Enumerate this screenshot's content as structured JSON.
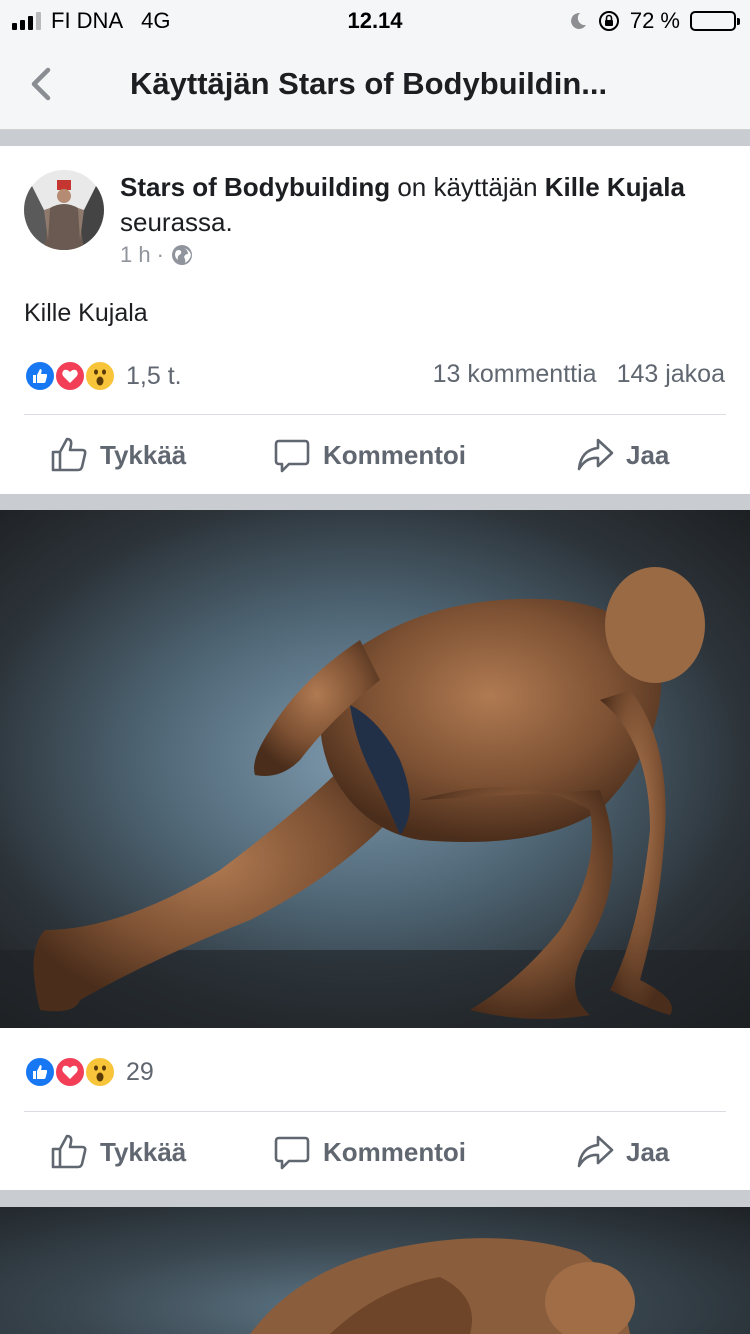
{
  "status_bar": {
    "carrier": "FI DNA",
    "network": "4G",
    "time": "12.14",
    "battery_text": "72 %",
    "battery_level": 0.72
  },
  "nav": {
    "back_icon": "chevron-left-icon",
    "title": "Käyttäjän Stars of Bodybuildin..."
  },
  "post": {
    "author": "Stars of Bodybuilding",
    "header_mid": " on käyttäjän ",
    "tagged": "Kille Kujala",
    "header_end": " seurassa.",
    "time": "1 h",
    "separator": "·",
    "privacy_icon": "globe-icon",
    "text": "Kille Kujala",
    "reaction_count": "1,5 t.",
    "comments": "13 kommenttia",
    "shares": "143 jakoa"
  },
  "actions": {
    "like": "Tykkää",
    "comment": "Kommentoi",
    "share": "Jaa"
  },
  "photo1": {
    "reaction_count": "29"
  },
  "colors": {
    "like_blue": "#1877f2",
    "love_red": "#f33e58",
    "wow_yellow": "#f7c43a",
    "text_primary": "#1c1e21",
    "text_secondary": "#606770",
    "divider_band": "#c9ccd1"
  }
}
